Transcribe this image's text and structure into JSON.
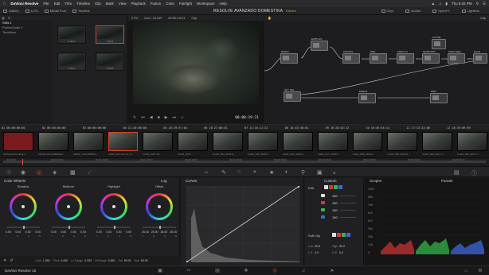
{
  "menubar": {
    "app": "DaVinci Resolve",
    "items": [
      "File",
      "Edit",
      "Trim",
      "Timeline",
      "Clip",
      "Mark",
      "View",
      "Playback",
      "Fusion",
      "Color",
      "Fairlight",
      "Workspace",
      "Help"
    ],
    "clock": "Thu 5:32 PM"
  },
  "toolbar": {
    "gallery": "Gallery",
    "luts": "LUTs",
    "media_pool": "Media Pool",
    "timeline": "Timeline",
    "project_title": "RESOLVE AVANZADO DOMESTIKA",
    "project_status": "Edited",
    "clips": "Clips",
    "nodes": "Nodes",
    "openfx": "OpenFX",
    "lightbox": "Lightbox"
  },
  "media_pool": {
    "albums": [
      "Stills 1",
      "PowerGrade 1",
      "Timelines"
    ],
    "thumbs": [
      "1.42.1",
      "1.42.2",
      "1.43.1",
      "1.44.1"
    ]
  },
  "viewer": {
    "zoom": "27%",
    "clip_name": "Cort...OLOR",
    "timecode_top": "00:00:19:21",
    "clip_label": "Clip",
    "timecode": "00:00:19:21"
  },
  "node_editor": {
    "zoom": "Clip",
    "nodes": [
      "RUIDO",
      "EXPO HS",
      "CURVAS",
      "PIEL",
      "FIELD Vs",
      "SHADOWS",
      "MANI CIER",
      "ACTOR",
      "FACE",
      "SKY SEL",
      "ENRO1",
      "MAN"
    ]
  },
  "clip_strip": {
    "timecodes": [
      "01  00:00:00:00",
      "02  00:00:00:00",
      "03  00:00:00:00",
      "04  11:20:00:00",
      "05  20:29:57:04",
      "06  16:27:08:01",
      "07  11:16:11:22",
      "08  16:43:48:01",
      "09  16:28:02:22",
      "10  16:46:54:14",
      "11  17:13:22:08",
      "12  16:39:09:09",
      "13  12:37:27:16",
      "14  17:17:17:17"
    ],
    "names": [
      "Universal Counting L...",
      "VOICE COLORIMASIS...",
      "Sel001_COLORMAS...",
      "Cut01_2017-10-14_17...",
      "Cut01_2017-10-...",
      "Cut01_2017-...",
      "Cut01_004_2018-0...",
      "Cut01_005_2018-0...",
      "Cut01_006_2018-0...",
      "Cut01_007_2018-0...",
      "Cut01_008_2018-0...",
      "Cut01_009_2018-0...",
      "Cut01_002_2017-1...",
      "Cut01_003_2017-1..."
    ]
  },
  "timeline": {
    "marks": [
      "00:00:00",
      "00:00:19:21",
      "00:01:15:00",
      "00:01:45:00",
      "00:02:15:00",
      "00:02:45:00",
      "00:03:15:00",
      "00:03:45:00",
      "00:04:15:00",
      "00:04:45:00",
      "00:05:15:00"
    ]
  },
  "color_wheels": {
    "title": "Color Wheels",
    "mode": "Log",
    "wheels": [
      {
        "name": "Shadow",
        "values": [
          "0.00",
          "0.00",
          "0.00",
          "0.00"
        ]
      },
      {
        "name": "Midtone",
        "values": [
          "0.00",
          "0.00",
          "0.00",
          "0.00"
        ]
      },
      {
        "name": "Highlight",
        "values": [
          "0.00",
          "0.00",
          "0.00",
          "0.00"
        ]
      },
      {
        "name": "Offset",
        "values": [
          "25.00",
          "25.00",
          "25.00",
          "25.00"
        ]
      }
    ],
    "channel_labels": [
      "Y",
      "R",
      "G",
      "B"
    ],
    "params": [
      {
        "label": "Cont",
        "value": "1.250"
      },
      {
        "label": "Pivot",
        "value": "0.400"
      },
      {
        "label": "Lo Range",
        "value": "0.333"
      },
      {
        "label": "Hi Range",
        "value": "0.550"
      },
      {
        "label": "Sat",
        "value": "50.00"
      },
      {
        "label": "Hue",
        "value": "50.00"
      }
    ]
  },
  "curves": {
    "title": "Curves"
  },
  "custom": {
    "title": "Custom",
    "edit_label": "Edit",
    "rows": [
      {
        "color": "#e0e0e0",
        "value": "100"
      },
      {
        "color": "#d23a3a",
        "value": "100"
      },
      {
        "color": "#3ab44a",
        "value": "100"
      },
      {
        "color": "#3a6ad2",
        "value": "100"
      }
    ],
    "soft_clip": "Soft Clip",
    "low": "50.0",
    "high": "50.0",
    "ls": "0.0",
    "hs": "0.0"
  },
  "scopes": {
    "title": "Scopes",
    "mode": "Parade",
    "scale": [
      "1023",
      "896",
      "768",
      "640",
      "512",
      "384",
      "256",
      "128",
      "0"
    ]
  },
  "pagebar": {
    "brand": "DaVinci Resolve 15"
  },
  "colors": {
    "accent": "#e34a2f",
    "selection": "#d2442c",
    "edited": "#e4a72e"
  }
}
